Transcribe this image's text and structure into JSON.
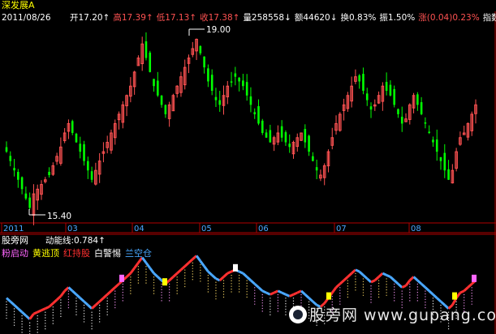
{
  "header": {
    "date": "2011/08/26",
    "items": [
      {
        "text": "开17.20↑",
        "color": "#ffffff"
      },
      {
        "text": "高17.39↑",
        "color": "#ff5252"
      },
      {
        "text": "低17.13↑",
        "color": "#ff5252"
      },
      {
        "text": "收17.38↑",
        "color": "#ff5252"
      },
      {
        "text": "量258558↓",
        "color": "#ffffff"
      },
      {
        "text": "额44620↓",
        "color": "#ffffff"
      },
      {
        "text": "换0.83%",
        "color": "#ffffff"
      },
      {
        "text": "振1.50%",
        "color": "#ffffff"
      },
      {
        "text": "涨(0.04)0.23%",
        "color": "#ff5252"
      },
      {
        "text": "指数",
        "color": "#ffffff"
      }
    ]
  },
  "stock_name": "深发展A",
  "annotations": {
    "high_label": "19.00",
    "low_label": "15.40"
  },
  "x_axis": {
    "labels": [
      "2011",
      "03",
      "04",
      "05",
      "06",
      "07",
      "08"
    ]
  },
  "indicator": {
    "title": "股旁网",
    "line_label": "动能线:0.784↑",
    "legend": [
      {
        "text": "粉启动",
        "color": "#ff66ff"
      },
      {
        "text": "黄逃顶",
        "color": "#ffff00"
      },
      {
        "text": "红持股",
        "color": "#ff3030"
      },
      {
        "text": "白警惕",
        "color": "#ffffff"
      },
      {
        "text": "兰空仓",
        "color": "#4aa8ff"
      }
    ]
  },
  "watermark": "股旁网 www.gupang.com",
  "colors": {
    "up": "#ff5252",
    "down": "#00ff00",
    "axis": "#b00000",
    "blue": "#4aa8ff"
  },
  "chart_data": {
    "type": "candlestick",
    "title": "深发展A",
    "x_ticks": [
      "2011",
      "03",
      "04",
      "05",
      "06",
      "07",
      "08"
    ],
    "marked_high": 19.0,
    "marked_low": 15.4,
    "close": [
      16.6,
      16.4,
      16.2,
      16.0,
      15.8,
      15.6,
      15.4,
      15.7,
      15.8,
      15.9,
      16.0,
      16.1,
      16.3,
      16.5,
      16.7,
      17.0,
      17.2,
      17.0,
      16.8,
      16.6,
      16.4,
      16.2,
      16.0,
      16.2,
      16.4,
      16.6,
      16.8,
      17.0,
      17.2,
      17.4,
      17.6,
      17.8,
      18.0,
      18.3,
      18.6,
      18.9,
      18.6,
      18.3,
      18.0,
      17.8,
      17.6,
      17.4,
      17.6,
      17.8,
      18.0,
      18.2,
      18.4,
      18.6,
      18.8,
      19.0,
      18.7,
      18.4,
      18.1,
      17.9,
      17.7,
      17.6,
      17.8,
      18.0,
      18.1,
      18.2,
      18.1,
      18.0,
      17.8,
      17.6,
      17.4,
      17.2,
      17.0,
      16.9,
      16.8,
      16.9,
      17.0,
      16.9,
      16.8,
      16.7,
      16.8,
      16.9,
      17.0,
      16.8,
      16.6,
      16.4,
      16.2,
      16.1,
      16.3,
      16.6,
      16.9,
      17.2,
      17.4,
      17.6,
      17.8,
      18.0,
      18.2,
      18.1,
      17.9,
      17.7,
      17.5,
      17.6,
      17.8,
      18.0,
      17.9,
      17.8,
      17.6,
      17.4,
      17.2,
      17.3,
      17.6,
      17.8,
      17.6,
      17.4,
      17.2,
      17.0,
      16.8,
      16.6,
      16.4,
      16.2,
      16.0,
      16.2,
      16.6,
      16.9,
      17.0,
      17.2,
      17.4,
      17.6
    ]
  }
}
